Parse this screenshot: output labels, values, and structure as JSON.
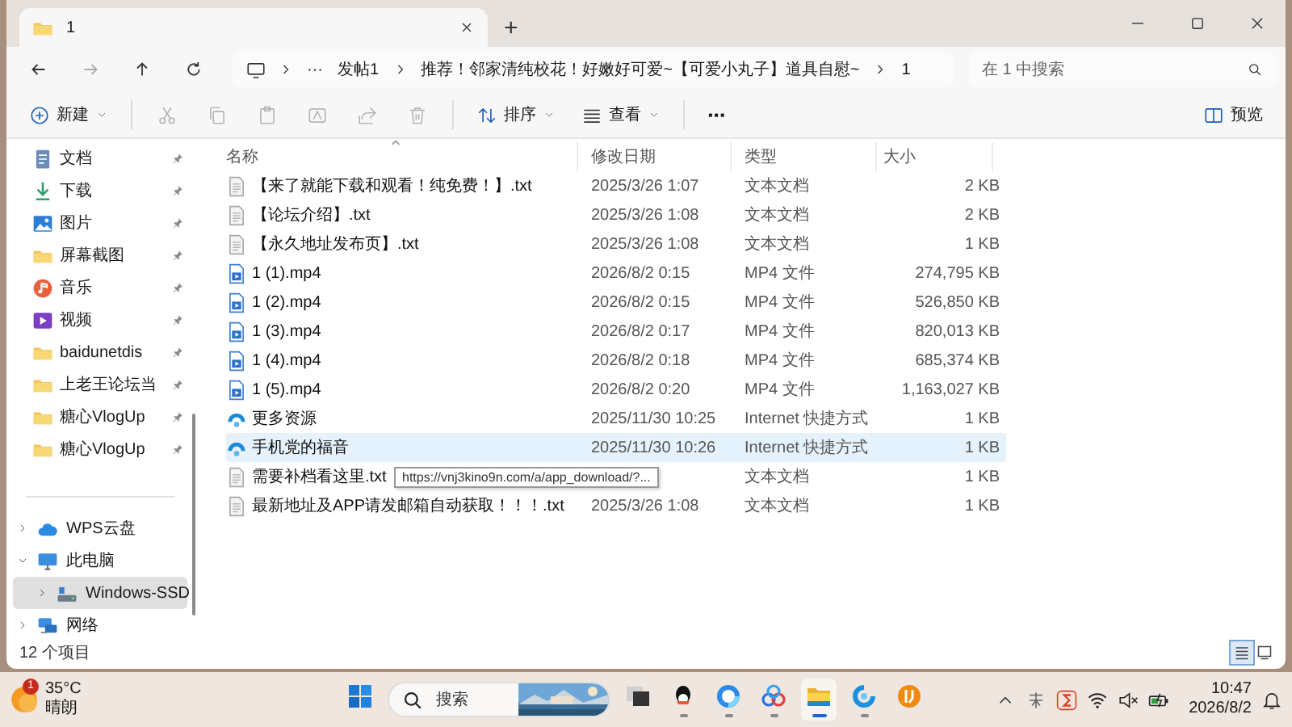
{
  "window": {
    "tabs": [
      {
        "title": "1",
        "selected": true
      }
    ],
    "new_tab": "+"
  },
  "address_bar": {
    "more": "···",
    "crumbs": [
      "发帖1",
      "推荐！邻家清纯校花！好嫩好可爱~【可爱小丸子】道具自慰~",
      "1"
    ]
  },
  "search": {
    "placeholder": "在 1 中搜索"
  },
  "toolbar": {
    "new": "新建",
    "actions": [
      {
        "kind": "cut",
        "disabled": true
      },
      {
        "kind": "copy",
        "disabled": true
      },
      {
        "kind": "paste",
        "disabled": true
      },
      {
        "kind": "rename",
        "disabled": true
      },
      {
        "kind": "share",
        "disabled": true
      },
      {
        "kind": "delete",
        "disabled": true
      }
    ],
    "sort": "排序",
    "view": "查看",
    "more": "···",
    "preview": "预览"
  },
  "sidebar": {
    "quick_access": [
      {
        "label": "文档",
        "kind": "documents",
        "pinned": true
      },
      {
        "label": "下载",
        "kind": "downloads",
        "pinned": true
      },
      {
        "label": "图片",
        "kind": "pictures",
        "pinned": true
      },
      {
        "label": "屏幕截图",
        "kind": "folder",
        "pinned": true
      },
      {
        "label": "音乐",
        "kind": "music",
        "pinned": true
      },
      {
        "label": "视频",
        "kind": "videos",
        "pinned": true
      },
      {
        "label": "baidunetdis",
        "kind": "folder",
        "pinned": true
      },
      {
        "label": "上老王论坛当",
        "kind": "folder",
        "pinned": true
      },
      {
        "label": "糖心VlogUp",
        "kind": "folder",
        "pinned": true
      },
      {
        "label": "糖心VlogUp",
        "kind": "folder",
        "pinned": true
      }
    ],
    "tree": [
      {
        "label": "WPS云盘",
        "kind": "cloud",
        "expanded": false,
        "selected": false
      },
      {
        "label": "此电脑",
        "kind": "pc",
        "expanded": true,
        "selected": false,
        "children": [
          {
            "label": "Windows-SSD",
            "kind": "drive",
            "expanded": false,
            "selected": true
          }
        ]
      },
      {
        "label": "网络",
        "kind": "network",
        "expanded": false,
        "selected": false
      }
    ]
  },
  "table": {
    "columns": [
      {
        "label": "名称",
        "sorted": true
      },
      {
        "label": "修改日期",
        "sorted": false
      },
      {
        "label": "类型",
        "sorted": false
      },
      {
        "label": "大小",
        "sorted": false
      }
    ],
    "rows": [
      {
        "kind": "txt",
        "name": "【来了就能下载和观看！纯免费！】.txt",
        "date": "2025/3/26 1:07",
        "type": "文本文档",
        "size": "2 KB",
        "selected": false
      },
      {
        "kind": "txt",
        "name": "【论坛介绍】.txt",
        "date": "2025/3/26 1:08",
        "type": "文本文档",
        "size": "2 KB",
        "selected": false
      },
      {
        "kind": "txt",
        "name": "【永久地址发布页】.txt",
        "date": "2025/3/26 1:08",
        "type": "文本文档",
        "size": "1 KB",
        "selected": false
      },
      {
        "kind": "mp4",
        "name": "1 (1).mp4",
        "date": "2026/8/2 0:15",
        "type": "MP4 文件",
        "size": "274,795 KB",
        "selected": false
      },
      {
        "kind": "mp4",
        "name": "1 (2).mp4",
        "date": "2026/8/2 0:15",
        "type": "MP4 文件",
        "size": "526,850 KB",
        "selected": false
      },
      {
        "kind": "mp4",
        "name": "1 (3).mp4",
        "date": "2026/8/2 0:17",
        "type": "MP4 文件",
        "size": "820,013 KB",
        "selected": false
      },
      {
        "kind": "mp4",
        "name": "1 (4).mp4",
        "date": "2026/8/2 0:18",
        "type": "MP4 文件",
        "size": "685,374 KB",
        "selected": false
      },
      {
        "kind": "mp4",
        "name": "1 (5).mp4",
        "date": "2026/8/2 0:20",
        "type": "MP4 文件",
        "size": "1,163,027 KB",
        "selected": false
      },
      {
        "kind": "url",
        "name": "更多资源",
        "date": "2025/11/30 10:25",
        "type": "Internet 快捷方式",
        "size": "1 KB",
        "selected": false
      },
      {
        "kind": "url",
        "name": "手机党的福音",
        "date": "2025/11/30 10:26",
        "type": "Internet 快捷方式",
        "size": "1 KB",
        "selected": true
      },
      {
        "kind": "txt",
        "name": "需要补档看这里.txt",
        "type": "文本文档",
        "size": "1 KB",
        "selected": false
      },
      {
        "kind": "txt",
        "name": "最新地址及APP请发邮箱自动获取！！！.txt",
        "date": "2025/3/26 1:08",
        "type": "文本文档",
        "size": "1 KB",
        "selected": false
      }
    ]
  },
  "tooltip": "https://vnj3kino9n.com/a/app_download/?...",
  "status_bar": {
    "count": "12 个项目",
    "views": [
      {
        "kind": "details",
        "selected": true
      },
      {
        "kind": "tiles",
        "selected": false
      }
    ]
  },
  "taskbar": {
    "weather": {
      "badge": "1",
      "temp": "35°C",
      "condition": "晴朗"
    },
    "search": {
      "placeholder": "搜索"
    },
    "apps": [
      {
        "kind": "start",
        "running": false,
        "active": false
      },
      {
        "kind": "taskview",
        "running": false,
        "active": false
      },
      {
        "kind": "qq",
        "running": true,
        "active": false
      },
      {
        "kind": "browser",
        "running": true,
        "active": false
      },
      {
        "kind": "cloud",
        "running": true,
        "active": false
      },
      {
        "kind": "explorer",
        "running": true,
        "active": true
      },
      {
        "kind": "swirl",
        "running": true,
        "active": false
      },
      {
        "kind": "orange",
        "running": false,
        "active": false
      }
    ],
    "time": "10:47",
    "date": "2026/8/2"
  }
}
